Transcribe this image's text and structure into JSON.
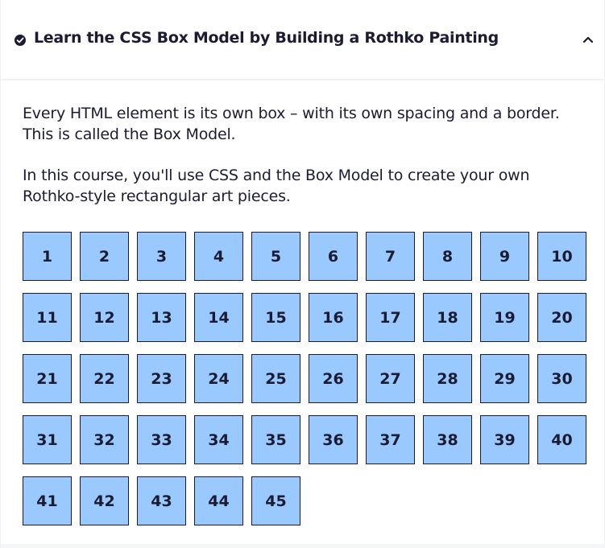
{
  "block": {
    "title": "Learn the CSS Box Model by Building a Rothko Painting",
    "completed_icon": "check-circle-icon",
    "toggle_icon": "chevron-up-icon"
  },
  "description": {
    "paragraph_1": "Every HTML element is its own box – with its own spacing and a border. This is called the Box Model.",
    "paragraph_2": "In this course, you'll use CSS and the Box Model to create your own Rothko-style rectangular art pieces."
  },
  "steps": [
    "1",
    "2",
    "3",
    "4",
    "5",
    "6",
    "7",
    "8",
    "9",
    "10",
    "11",
    "12",
    "13",
    "14",
    "15",
    "16",
    "17",
    "18",
    "19",
    "20",
    "21",
    "22",
    "23",
    "24",
    "25",
    "26",
    "27",
    "28",
    "29",
    "30",
    "31",
    "32",
    "33",
    "34",
    "35",
    "36",
    "37",
    "38",
    "39",
    "40",
    "41",
    "42",
    "43",
    "44",
    "45"
  ],
  "colors": {
    "step_fill": "#99c9ff",
    "step_border": "#1b1b32",
    "text": "#1b1b32"
  }
}
